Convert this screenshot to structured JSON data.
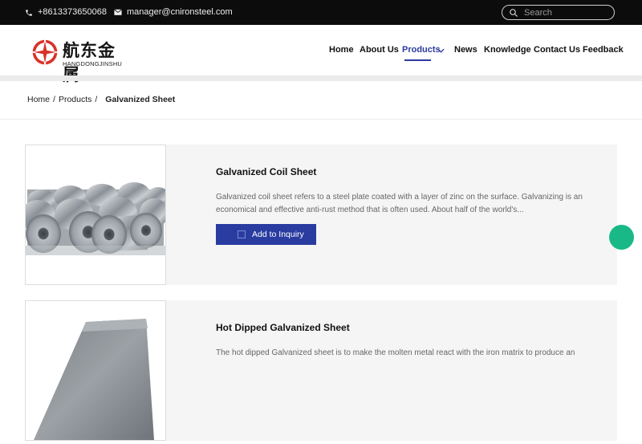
{
  "topbar": {
    "phone": "+8613373650068",
    "email": "manager@cnironsteel.com",
    "search_placeholder": "Search"
  },
  "brand": {
    "name_cn": "航东金属",
    "name_en": "HANGDONGJINSHU"
  },
  "nav": {
    "items": [
      "Home",
      "About Us",
      "Products",
      "News",
      "Knowledge",
      "Contact Us",
      "Feedback"
    ],
    "active": "Products"
  },
  "breadcrumb": {
    "items": [
      "Home",
      "Products"
    ],
    "current": "Galvanized Sheet"
  },
  "products": [
    {
      "title": "Galvanized Coil Sheet",
      "description": "Galvanized coil sheet refers to a steel plate coated with a layer of zinc on the surface. Galvanizing is an economical and effective anti-rust method that is often used. About half of the world's...",
      "button": "Add to Inquiry"
    },
    {
      "title": "Hot Dipped Galvanized Sheet",
      "description": "The hot dipped Galvanized sheet is to make the molten metal react with the iron matrix to produce an"
    }
  ],
  "colors": {
    "topbar_bg": "#0c0c0c",
    "accent": "#2a3ca0",
    "float_button": "#19b987",
    "card_bg": "#f5f5f5"
  }
}
